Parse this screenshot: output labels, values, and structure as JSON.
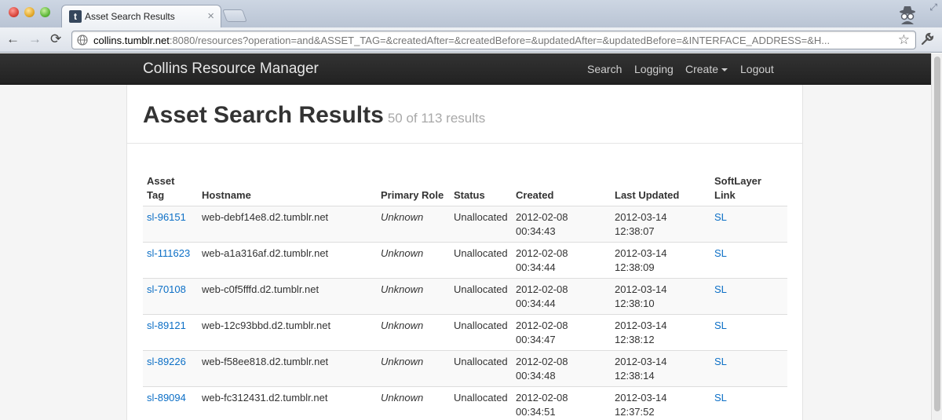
{
  "browser": {
    "tab_title": "Asset Search Results",
    "tab_close": "×",
    "favicon_letter": "t",
    "url_host": "collins.tumblr.net",
    "url_rest": ":8080/resources?operation=and&ASSET_TAG=&createdAfter=&createdBefore=&updatedAfter=&updatedBefore=&INTERFACE_ADDRESS=&H...",
    "nav": {
      "back": "←",
      "forward": "→",
      "reload": "⟳",
      "star": "☆"
    }
  },
  "navbar": {
    "brand": "Collins Resource Manager",
    "links": {
      "search": "Search",
      "logging": "Logging",
      "create": "Create",
      "logout": "Logout"
    }
  },
  "header": {
    "title": "Asset Search Results",
    "count": "50 of 113 results"
  },
  "table": {
    "columns": {
      "asset_tag": [
        "Asset",
        "Tag"
      ],
      "hostname": "Hostname",
      "primary_role": "Primary Role",
      "status": "Status",
      "created": "Created",
      "last_updated": "Last Updated",
      "softlayer": [
        "SoftLayer",
        "Link"
      ]
    },
    "rows": [
      {
        "tag": "sl-96151",
        "hostname": "web-debf14e8.d2.tumblr.net",
        "role": "Unknown",
        "status": "Unallocated",
        "created_date": "2012-02-08",
        "created_time": "00:34:43",
        "updated_date": "2012-03-14",
        "updated_time": "12:38:07",
        "link": "SL"
      },
      {
        "tag": "sl-111623",
        "hostname": "web-a1a316af.d2.tumblr.net",
        "role": "Unknown",
        "status": "Unallocated",
        "created_date": "2012-02-08",
        "created_time": "00:34:44",
        "updated_date": "2012-03-14",
        "updated_time": "12:38:09",
        "link": "SL"
      },
      {
        "tag": "sl-70108",
        "hostname": "web-c0f5fffd.d2.tumblr.net",
        "role": "Unknown",
        "status": "Unallocated",
        "created_date": "2012-02-08",
        "created_time": "00:34:44",
        "updated_date": "2012-03-14",
        "updated_time": "12:38:10",
        "link": "SL"
      },
      {
        "tag": "sl-89121",
        "hostname": "web-12c93bbd.d2.tumblr.net",
        "role": "Unknown",
        "status": "Unallocated",
        "created_date": "2012-02-08",
        "created_time": "00:34:47",
        "updated_date": "2012-03-14",
        "updated_time": "12:38:12",
        "link": "SL"
      },
      {
        "tag": "sl-89226",
        "hostname": "web-f58ee818.d2.tumblr.net",
        "role": "Unknown",
        "status": "Unallocated",
        "created_date": "2012-02-08",
        "created_time": "00:34:48",
        "updated_date": "2012-03-14",
        "updated_time": "12:38:14",
        "link": "SL"
      },
      {
        "tag": "sl-89094",
        "hostname": "web-fc312431.d2.tumblr.net",
        "role": "Unknown",
        "status": "Unallocated",
        "created_date": "2012-02-08",
        "created_time": "00:34:51",
        "updated_date": "2012-03-14",
        "updated_time": "12:37:52",
        "link": "SL"
      }
    ]
  },
  "colors": {
    "navbar": "#222222",
    "link": "#0c6fc6",
    "muted": "#a8a8a8"
  }
}
